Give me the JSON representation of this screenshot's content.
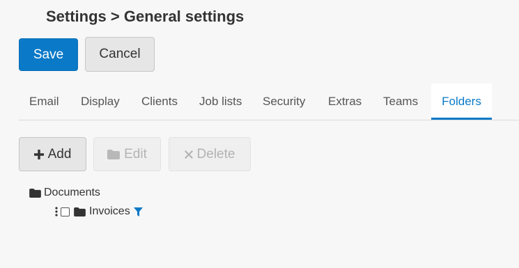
{
  "breadcrumb": "Settings > General settings",
  "actions": {
    "save_label": "Save",
    "cancel_label": "Cancel"
  },
  "tabs": [
    {
      "label": "Email"
    },
    {
      "label": "Display"
    },
    {
      "label": "Clients"
    },
    {
      "label": "Job lists"
    },
    {
      "label": "Security"
    },
    {
      "label": "Extras"
    },
    {
      "label": "Teams"
    },
    {
      "label": "Folders",
      "active": true
    }
  ],
  "toolbar": {
    "add_label": "Add",
    "edit_label": "Edit",
    "delete_label": "Delete"
  },
  "tree": {
    "root": {
      "label": "Documents",
      "icon": "folder-icon"
    },
    "children": [
      {
        "label": "Invoices",
        "icon": "folder-icon",
        "checked": false,
        "filter_icon": "filter-icon"
      }
    ]
  },
  "colors": {
    "accent": "#0a79c7",
    "disabled_text": "#b3b3b3"
  }
}
